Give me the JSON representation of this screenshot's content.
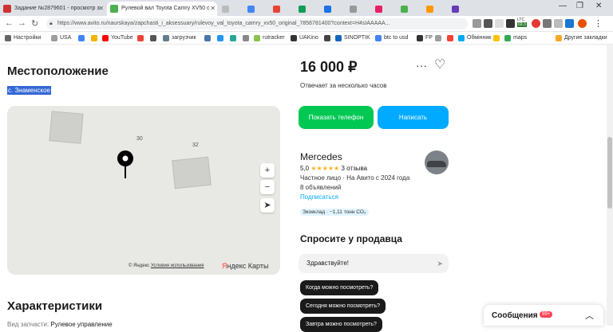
{
  "browser": {
    "tabs": [
      {
        "title": "Задание №2879601 - просмотр з",
        "fav": "#c33"
      },
      {
        "title": "Рулевой вал Toyota Camry XV50 с",
        "fav": "#4caf50"
      }
    ],
    "url": "https://www.avito.ru/naurskaya/zapchasti_i_aksessuary/rulevoy_val_toyota_camry_xv50_original_7856781400?context=H4sIAAAAA...",
    "ext_badges": {
      "ltc": "LTC",
      "ltc_val": "69.3"
    },
    "bookmarks": [
      "Настройки",
      "USA",
      "",
      "",
      "YouTube",
      "",
      "",
      "загрузчик",
      "",
      "",
      "",
      "",
      "rutracker",
      "UAKino",
      "",
      "SINOPTIK",
      "btc to usd",
      "FP",
      "",
      "",
      "Обмінник",
      "",
      "maps"
    ],
    "other_bookmarks": "Другие закладки"
  },
  "listing": {
    "location_heading": "Местоположение",
    "location_value": "с. Знаменское",
    "house_numbers": [
      "30",
      "32"
    ],
    "map_copyright": "© Яндекс",
    "map_terms": "Условия использования",
    "map_brand_a": "Я",
    "map_brand_b": "ндекс Карты",
    "characteristics_heading": "Характеристики",
    "spec_label": "Вид запчасти:",
    "spec_value": "Рулевое управление",
    "price": "16 000 ₽",
    "reply_time": "Отвечает за несколько часов",
    "show_phone": "Показать телефон",
    "write": "Написать",
    "seller_name": "Mercedes",
    "rating_value": "5,0",
    "stars": "★★★★★",
    "reviews": "3 отзыва",
    "seller_type": "Частное лицо · На Авито с 2024 года",
    "ads_count": "8 объявлений",
    "subscribe": "Подписаться",
    "eco": "Экокклад · −1,11 тонн CO₂",
    "ask_heading": "Спросите у продавца",
    "msg_placeholder": "Здравствуйте!",
    "quick_questions": [
      "Когда можно посмотреть?",
      "Сегодня можно посмотреть?",
      "Завтра можно посмотреть?"
    ],
    "messenger_title": "Сообщения",
    "messenger_badge": "99+"
  }
}
